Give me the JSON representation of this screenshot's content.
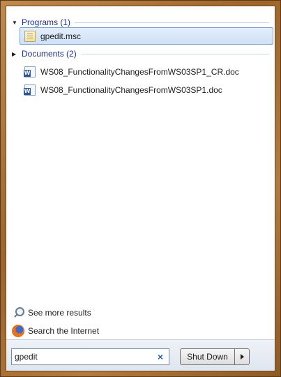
{
  "programs": {
    "header": "Programs (1)",
    "items": [
      {
        "label": "gpedit.msc",
        "icon": "msc-file-icon",
        "selected": true
      }
    ]
  },
  "documents": {
    "header": "Documents (2)",
    "items": [
      {
        "label": "WS08_FunctionalityChangesFromWS03SP1_CR.doc",
        "icon": "word-doc-icon"
      },
      {
        "label": "WS08_FunctionalityChangesFromWS03SP1.doc",
        "icon": "word-doc-icon"
      }
    ]
  },
  "links": {
    "see_more": "See more results",
    "search_internet": "Search the Internet"
  },
  "search": {
    "value": "gpedit"
  },
  "power": {
    "shutdown_label": "Shut Down"
  },
  "colors": {
    "frame": "#a86c30",
    "header_text": "#1e3287",
    "selection": "#cfe1f6"
  }
}
